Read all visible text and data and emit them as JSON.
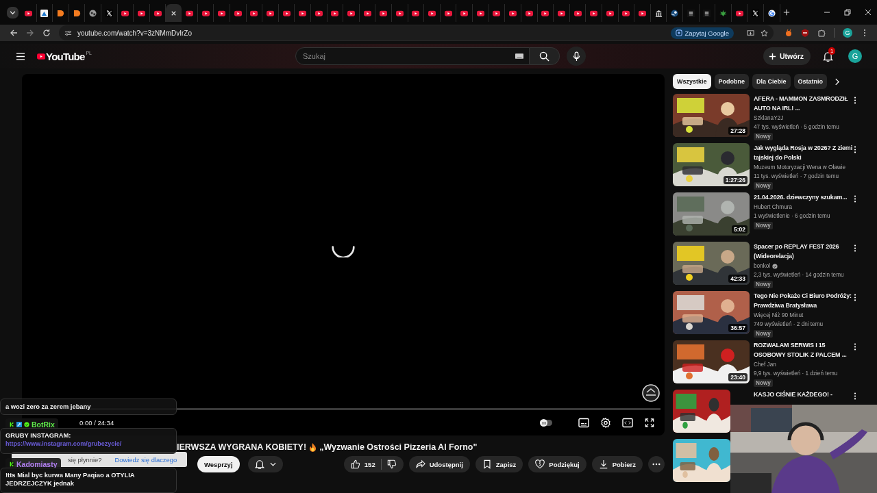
{
  "browser": {
    "tabs": [
      {
        "kind": "youtube",
        "selected": false
      },
      {
        "kind": "app",
        "selected": false
      },
      {
        "kind": "orange",
        "selected": false
      },
      {
        "kind": "orange",
        "selected": false
      },
      {
        "kind": "globe",
        "selected": false
      },
      {
        "kind": "x",
        "selected": false
      },
      {
        "kind": "youtube",
        "selected": false
      },
      {
        "kind": "youtube",
        "selected": false
      },
      {
        "kind": "youtube",
        "selected": false
      },
      {
        "selected": true
      },
      {
        "kind": "youtube",
        "selected": false
      },
      {
        "kind": "youtube",
        "selected": false
      },
      {
        "kind": "youtube",
        "selected": false
      },
      {
        "kind": "youtube",
        "selected": false
      },
      {
        "kind": "youtube",
        "selected": false
      },
      {
        "kind": "youtube",
        "selected": false
      },
      {
        "kind": "youtube",
        "selected": false
      },
      {
        "kind": "youtube",
        "selected": false
      },
      {
        "kind": "youtube",
        "selected": false
      },
      {
        "kind": "youtube",
        "selected": false
      },
      {
        "kind": "youtube",
        "selected": false
      },
      {
        "kind": "youtube",
        "selected": false
      },
      {
        "kind": "youtube",
        "selected": false
      },
      {
        "kind": "youtube",
        "selected": false
      },
      {
        "kind": "youtube",
        "selected": false
      },
      {
        "kind": "youtube",
        "selected": false
      },
      {
        "kind": "youtube",
        "selected": false
      },
      {
        "kind": "youtube",
        "selected": false
      },
      {
        "kind": "youtube",
        "selected": false
      },
      {
        "kind": "youtube",
        "selected": false
      },
      {
        "kind": "youtube",
        "selected": false
      },
      {
        "kind": "youtube",
        "selected": false
      },
      {
        "kind": "youtube",
        "selected": false
      },
      {
        "kind": "youtube",
        "selected": false
      },
      {
        "kind": "youtube",
        "selected": false
      },
      {
        "kind": "youtube",
        "selected": false
      },
      {
        "kind": "youtube",
        "selected": false
      },
      {
        "kind": "youtube",
        "selected": false
      },
      {
        "kind": "youtube",
        "selected": false
      },
      {
        "kind": "bank",
        "selected": false
      },
      {
        "kind": "steam",
        "selected": false
      },
      {
        "kind": "dark",
        "selected": false
      },
      {
        "kind": "dark",
        "selected": false
      },
      {
        "kind": "leaf",
        "selected": false
      },
      {
        "kind": "youtube",
        "selected": false
      },
      {
        "kind": "x",
        "selected": false
      },
      {
        "kind": "google",
        "selected": false
      }
    ],
    "address": "youtube.com/watch?v=3zNMmDvIrZo",
    "ask_button": "Zapytaj Google",
    "profile_initial": "G"
  },
  "youtube": {
    "logo": "YouTube",
    "region": "PL",
    "search": {
      "placeholder": "Szukaj"
    },
    "create_button": "Utwórz",
    "notification_count": "1",
    "avatar_initial": "G"
  },
  "player": {
    "loading": true,
    "time": "0:00 / 24:34",
    "autoplay_on": false
  },
  "video": {
    "title_parts": [
      "IERWSZA WYGRANA KOBIETY!",
      "„Wyzwanie Ostrości Pizzeria Al Forno\""
    ],
    "support_button": "Wesprzyj",
    "likes": "152",
    "share": "Udostępnij",
    "save": "Zapisz",
    "thanks": "Podziękuj",
    "download": "Pobierz"
  },
  "playback_hint": {
    "text": "się płynnie?",
    "link": "Dowiedz się dlaczego"
  },
  "sidebar": {
    "chips": [
      {
        "label": "Wszystkie",
        "selected": true
      },
      {
        "label": "Podobne",
        "selected": false
      },
      {
        "label": "Dla Ciebie",
        "selected": false
      },
      {
        "label": "Ostatnio",
        "selected": false
      }
    ],
    "videos": [
      {
        "kind": "video",
        "title": "AFERA - MAMMON ZASMRODZIŁ AUTO NA IRL! ...",
        "channel": "SzklanaY2J",
        "verified": false,
        "meta": "47 tys. wyświetleń · 5 godzin temu",
        "badge": "Nowy",
        "duration": "27:28"
      },
      {
        "kind": "video",
        "title": "Jak wygląda Rosja w 2026? Z ziemi tajskiej do Polski",
        "channel": "Muzeum Motoryzacji Wena w Oławie",
        "verified": false,
        "meta": "11 tys. wyświetleń · 7 godzin temu",
        "badge": "Nowy",
        "duration": "1:27:26"
      },
      {
        "kind": "video",
        "title": "21.04.2026. dziewczyny szukam...",
        "channel": "Hubert Chmura",
        "verified": false,
        "meta": "1 wyświetlenie · 6 godzin temu",
        "badge": "Nowy",
        "duration": "5:02"
      },
      {
        "kind": "video",
        "title": "Spacer po REPLAY FEST 2026 (Wideorelacja)",
        "channel": "bonkol",
        "verified": true,
        "meta": "2,3 tys. wyświetleń · 14 godzin temu",
        "badge": "Nowy",
        "duration": "42:33"
      },
      {
        "kind": "video",
        "title": "Tego Nie Pokaże Ci Biuro Podróży: Prawdziwa Bratysława",
        "channel": "Więcej Niż 90 Minut",
        "verified": false,
        "meta": "749 wyświetleń · 2 dni temu",
        "badge": "Nowy",
        "duration": "36:57"
      },
      {
        "kind": "video",
        "title": "ROZWALAM SERWIS I 15 OSOBOWY STOLIK Z PALCEM ...",
        "channel": "Chef Jan",
        "verified": false,
        "meta": "9,9 tys. wyświetleń · 1 dzień temu",
        "badge": "Nowy",
        "duration": "23:40"
      },
      {
        "kind": "covered",
        "title": "KASJO CIŚNIE KAŻDEGO! -"
      },
      {
        "kind": "thumbnail_only"
      }
    ]
  },
  "chat": {
    "messages": [
      {
        "text": "a wozi zero za zerem jebany"
      },
      {
        "user": "BotRix",
        "color": "#5ee84a",
        "badges": [
          {
            "kind": "kick"
          },
          {
            "kind": "mod"
          },
          {
            "kind": "verified"
          }
        ],
        "text": "GRUBY INSTAGRAM:",
        "link": "https://www.instagram.com/grubezycie/"
      },
      {
        "user": "Kadomiasty",
        "color": "#b07ef0",
        "badges": [
          {
            "kind": "kick"
          }
        ],
        "text": "!tts Mial byc kurwa Many Paqiao a OTYLIA JEDRZEJCZYK jednak"
      }
    ]
  }
}
